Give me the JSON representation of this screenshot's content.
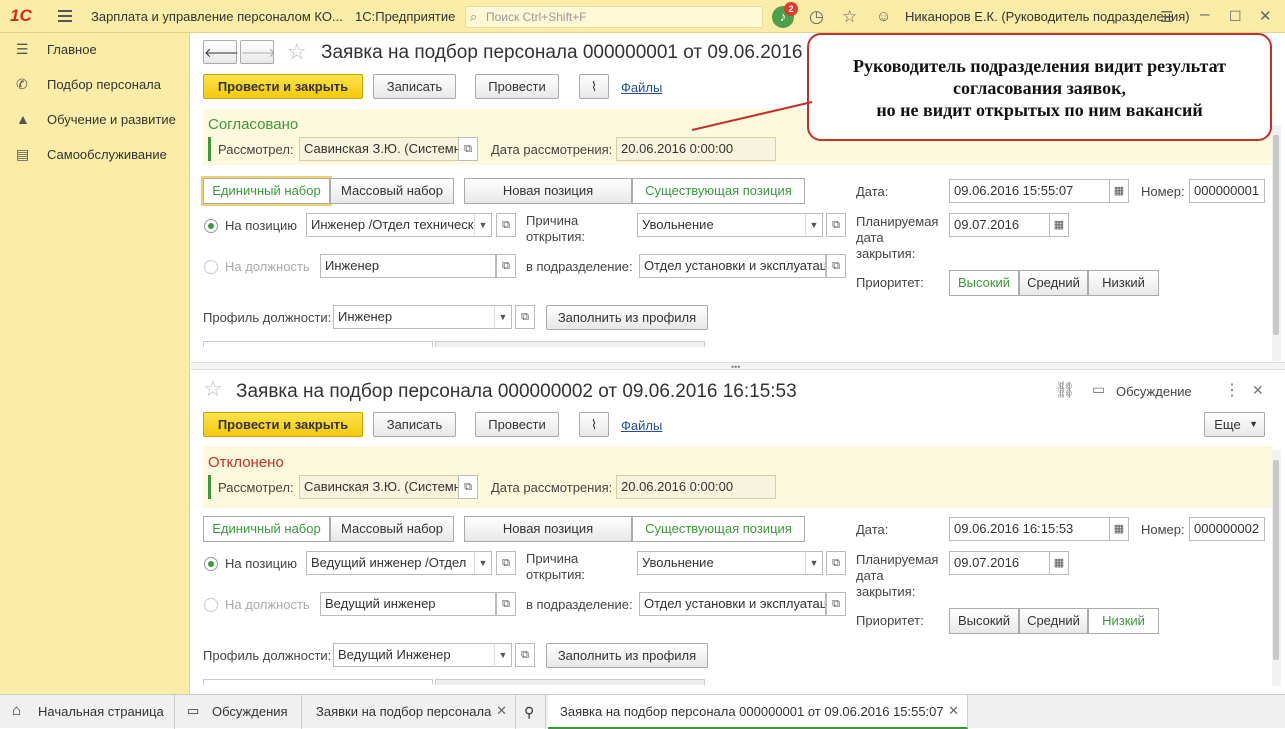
{
  "app": {
    "logo": "1С",
    "title": "Зарплата и управление персоналом КО...",
    "platform": "1С:Предприятие",
    "search_placeholder": "Поиск Ctrl+Shift+F",
    "notifications": "2",
    "user": "Никаноров Е.К. (Руководитель подразделения)"
  },
  "sidebar": {
    "items": [
      {
        "label": "Главное",
        "icon": "menu-icon"
      },
      {
        "label": "Подбор персонала",
        "icon": "phone-icon"
      },
      {
        "label": "Обучение и развитие",
        "icon": "graduation-cap-icon"
      },
      {
        "label": "Самообслуживание",
        "icon": "id-card-icon"
      }
    ]
  },
  "callout": {
    "line1": "Руководитель подразделения видит результат",
    "line2": "согласования заявок,",
    "line3": "но не видит открытых по ним вакансий"
  },
  "forms": [
    {
      "title": "Заявка на подбор персонала 000000001 от 09.06.2016 15:55:07",
      "btn_post_close": "Провести и закрыть",
      "btn_write": "Записать",
      "btn_post": "Провести",
      "files": "Файлы",
      "status": "Согласовано",
      "reviewed_label": "Рассмотрел:",
      "reviewed": "Савинская З.Ю. (Системн",
      "review_date_label": "Дата рассмотрения:",
      "review_date": "20.06.2016  0:00:00",
      "seg_single": "Единичный набор",
      "seg_mass": "Массовый набор",
      "seg_new": "Новая позиция",
      "seg_existing": "Существующая позиция",
      "radio_position": "На позицию",
      "position": "Инженер /Отдел техническ",
      "reason_label_1": "Причина",
      "reason_label_2": "открытия:",
      "reason": "Увольнение",
      "radio_job": "На должность",
      "job": "Инженер",
      "dept_label": "в подразделение:",
      "dept": "Отдел установки и эксплуатац",
      "profile_label": "Профиль должности:",
      "profile": "Инженер",
      "fill_profile": "Заполнить из профиля",
      "date_label": "Дата:",
      "date": "09.06.2016 15:55:07",
      "number_label": "Номер:",
      "number": "000000001",
      "plan_label_1": "Планируемая",
      "plan_label_2": "дата",
      "plan_label_3": "закрытия:",
      "plan_date": "09.07.2016",
      "priority_label": "Приоритет:",
      "prio_high": "Высокий",
      "prio_mid": "Средний",
      "prio_low": "Низкий",
      "priority_selected": "Высокий"
    },
    {
      "title": "Заявка на подбор персонала 000000002 от 09.06.2016 16:15:53",
      "btn_post_close": "Провести и закрыть",
      "btn_write": "Записать",
      "btn_post": "Провести",
      "files": "Файлы",
      "discussion": "Обсуждение",
      "more": "Еще",
      "status": "Отклонено",
      "reviewed_label": "Рассмотрел:",
      "reviewed": "Савинская З.Ю. (Системн",
      "review_date_label": "Дата рассмотрения:",
      "review_date": "20.06.2016  0:00:00",
      "seg_single": "Единичный набор",
      "seg_mass": "Массовый набор",
      "seg_new": "Новая позиция",
      "seg_existing": "Существующая позиция",
      "radio_position": "На позицию",
      "position": "Ведущий инженер /Отдел",
      "reason_label_1": "Причина",
      "reason_label_2": "открытия:",
      "reason": "Увольнение",
      "radio_job": "На должность",
      "job": "Ведущий инженер",
      "dept_label": "в подразделение:",
      "dept": "Отдел установки и эксплуатац",
      "profile_label": "Профиль должности:",
      "profile": "Ведущий Инженер",
      "fill_profile": "Заполнить из профиля",
      "date_label": "Дата:",
      "date": "09.06.2016 16:15:53",
      "number_label": "Номер:",
      "number": "000000002",
      "plan_label_1": "Планируемая",
      "plan_label_2": "дата",
      "plan_label_3": "закрытия:",
      "plan_date": "09.07.2016",
      "priority_label": "Приоритет:",
      "prio_high": "Высокий",
      "prio_mid": "Средний",
      "prio_low": "Низкий",
      "priority_selected": "Низкий"
    }
  ],
  "taskbar": {
    "home": "Начальная страница",
    "discussions": "Обсуждения",
    "requests": "Заявки на подбор персонала",
    "active": "Заявка на подбор персонала 000000001 от 09.06.2016 15:55:07"
  },
  "colors": {
    "accent_yellow": "#fbeda8",
    "approved": "#3a9a3a",
    "rejected": "#c0322a",
    "primary_button": "#f4c90c"
  }
}
